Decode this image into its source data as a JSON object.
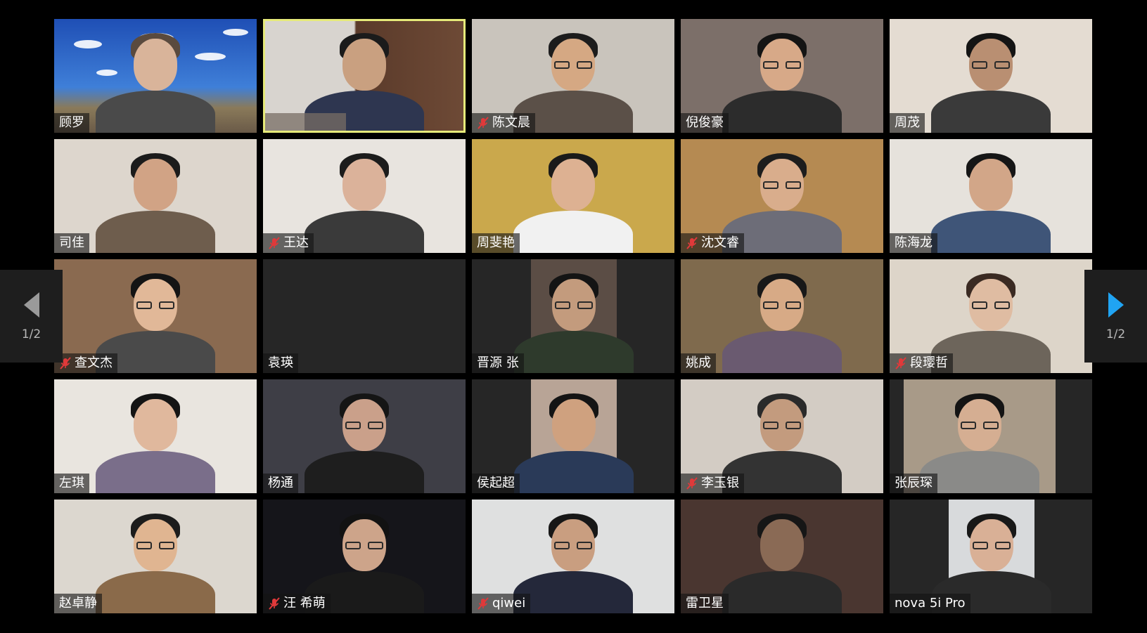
{
  "meeting": {
    "tiles": [
      {
        "name": "顾罗",
        "muted": false,
        "active": false,
        "bg": "#2c5fb8",
        "skin": "#d9b49a",
        "hair": "#5a4a3e",
        "shirt": "#4a4a4a",
        "feed": "full",
        "scene": "sky"
      },
      {
        "name": "",
        "muted": false,
        "active": true,
        "bg": "#6e4a36",
        "skin": "#c9a080",
        "hair": "#1b1b1b",
        "shirt": "#2e3650",
        "feed": "full",
        "scene": "office"
      },
      {
        "name": "陈文晨",
        "muted": true,
        "active": false,
        "bg": "#c9c4bc",
        "skin": "#d5a883",
        "hair": "#1c1c1c",
        "shirt": "#5b5048",
        "feed": "full",
        "glasses": true
      },
      {
        "name": "倪俊豪",
        "muted": false,
        "active": false,
        "bg": "#7c6f69",
        "skin": "#d7a988",
        "hair": "#141414",
        "shirt": "#2c2c2c",
        "feed": "full",
        "glasses": true
      },
      {
        "name": "周茂",
        "muted": false,
        "active": false,
        "bg": "#e4dcd2",
        "skin": "#b98f72",
        "hair": "#141414",
        "shirt": "#3a3a3a",
        "feed": "full",
        "glasses": true
      },
      {
        "name": "司佳",
        "muted": false,
        "active": false,
        "bg": "#ddd6cd",
        "skin": "#d1a385",
        "hair": "#1b1b1b",
        "shirt": "#6e5d4d",
        "feed": "full"
      },
      {
        "name": "王达",
        "muted": true,
        "active": false,
        "bg": "#e8e4df",
        "skin": "#dbb29a",
        "hair": "#1c1c1c",
        "shirt": "#3a3a3a",
        "feed": "full"
      },
      {
        "name": "周斐艳",
        "muted": false,
        "active": false,
        "bg": "#caa84c",
        "skin": "#ddb192",
        "hair": "#1a1a1a",
        "shirt": "#f1f1f1",
        "feed": "full"
      },
      {
        "name": "沈文睿",
        "muted": true,
        "active": false,
        "bg": "#b58a52",
        "skin": "#d9ad8c",
        "hair": "#1d1d1d",
        "shirt": "#6d6d78",
        "feed": "full",
        "glasses": true
      },
      {
        "name": "陈海龙",
        "muted": false,
        "active": false,
        "bg": "#e6e2dc",
        "skin": "#d2a688",
        "hair": "#161616",
        "shirt": "#3f5578",
        "feed": "full"
      },
      {
        "name": "查文杰",
        "muted": true,
        "active": false,
        "bg": "#8a6a50",
        "skin": "#e1b898",
        "hair": "#141414",
        "shirt": "#4a4a4a",
        "feed": "full",
        "glasses": true
      },
      {
        "name": "袁瑛",
        "muted": false,
        "active": false,
        "bg": "#262626",
        "feed": "none"
      },
      {
        "name": "晋源 张",
        "muted": false,
        "active": false,
        "bg": "#5b4d45",
        "skin": "#c39b7d",
        "hair": "#141414",
        "shirt": "#2e3a2c",
        "feed": "mid",
        "glasses": true
      },
      {
        "name": "姚成",
        "muted": false,
        "active": false,
        "bg": "#7f6a4d",
        "skin": "#d7aa86",
        "hair": "#181818",
        "shirt": "#6a5a70",
        "feed": "full",
        "glasses": true
      },
      {
        "name": "段璎哲",
        "muted": true,
        "active": false,
        "bg": "#ddd5c9",
        "skin": "#dfbca2",
        "hair": "#3a2a22",
        "shirt": "#6d655b",
        "feed": "full",
        "glasses": true
      },
      {
        "name": "左琪",
        "muted": false,
        "active": false,
        "bg": "#e9e5df",
        "skin": "#e0b89d",
        "hair": "#141414",
        "shirt": "#7a6e8a",
        "feed": "full"
      },
      {
        "name": "杨通",
        "muted": false,
        "active": false,
        "bg": "#3e3e46",
        "skin": "#caa08a",
        "hair": "#151515",
        "shirt": "#1e1e1e",
        "feed": "full",
        "glasses": true
      },
      {
        "name": "侯起超",
        "muted": false,
        "active": false,
        "bg": "#b8a496",
        "skin": "#cfa17f",
        "hair": "#141414",
        "shirt": "#2a3a58",
        "feed": "mid"
      },
      {
        "name": "李玉银",
        "muted": true,
        "active": false,
        "bg": "#d3ccc4",
        "skin": "#c39b7e",
        "hair": "#2a2a2a",
        "shirt": "#333333",
        "feed": "full",
        "glasses": true
      },
      {
        "name": "张辰琛",
        "muted": false,
        "active": false,
        "bg": "#a89a88",
        "skin": "#d5ae92",
        "hair": "#141414",
        "shirt": "#8a8a88",
        "feed": "wide",
        "glasses": true
      },
      {
        "name": "赵卓静",
        "muted": false,
        "active": false,
        "bg": "#dcd7cf",
        "skin": "#e0b591",
        "hair": "#1c1c1c",
        "shirt": "#8a6a4a",
        "feed": "full",
        "glasses": true
      },
      {
        "name": "汪 希萌",
        "muted": true,
        "active": false,
        "bg": "#15151a",
        "skin": "#cda48a",
        "hair": "#121212",
        "shirt": "#1a1a1a",
        "feed": "full",
        "glasses": true
      },
      {
        "name": "qiwei",
        "muted": true,
        "active": false,
        "bg": "#dfe0e0",
        "skin": "#c99e80",
        "hair": "#171717",
        "shirt": "#24283a",
        "feed": "full",
        "glasses": true
      },
      {
        "name": "雷卫星",
        "muted": false,
        "active": false,
        "bg": "#4a3630",
        "skin": "#8a6a55",
        "hair": "#161616",
        "shirt": "#2a2a2a",
        "feed": "full"
      },
      {
        "name": "nova 5i Pro",
        "muted": false,
        "active": false,
        "bg": "#d8dadc",
        "skin": "#d9b096",
        "hair": "#181818",
        "shirt": "#2a2a2a",
        "feed": "mid",
        "glasses": true
      }
    ]
  },
  "pager": {
    "left_label": "1/2",
    "right_label": "1/2",
    "left_icon": "triangle-left-icon",
    "right_icon": "triangle-right-icon",
    "right_color": "#20a4f3",
    "left_color": "#9a9a9a"
  }
}
